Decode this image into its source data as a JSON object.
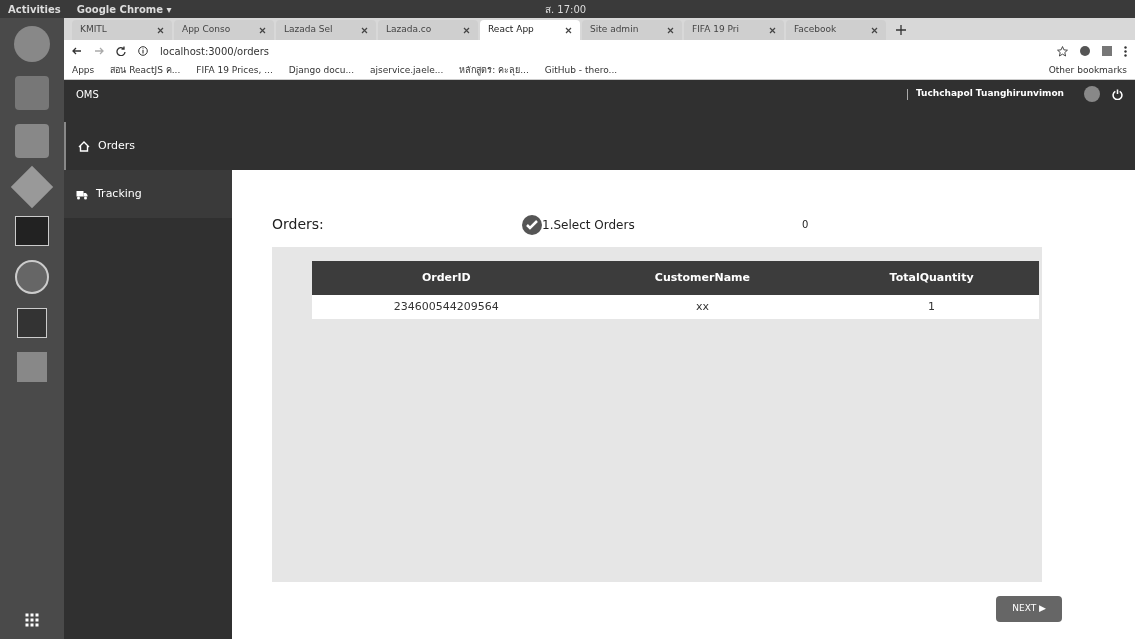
{
  "top_bar": {
    "activities": "Activities",
    "app_menu": "Google Chrome ▾",
    "clock": "ส. 17:00"
  },
  "tabs": [
    {
      "label": "KMITL",
      "selected": false
    },
    {
      "label": "App Conso",
      "selected": false
    },
    {
      "label": "Lazada Sel",
      "selected": false
    },
    {
      "label": "Lazada.co",
      "selected": false
    },
    {
      "label": "React App",
      "selected": true
    },
    {
      "label": "Site admin",
      "selected": false
    },
    {
      "label": "FIFA 19 Pri",
      "selected": false
    },
    {
      "label": "Facebook",
      "selected": false
    }
  ],
  "address": "localhost:3000/orders",
  "bookmarks": [
    "Apps",
    "สอน ReactJS ค...",
    "FIFA 19 Prices, ...",
    "Django docu...",
    "ajservice.jaele...",
    "หลักสูตร: คะลุย...",
    "GitHub - thero..."
  ],
  "other_bookmarks": "Other bookmarks",
  "app": {
    "brand": "OMS",
    "user": "Tuchchapol Tuanghirunvimon"
  },
  "sidebar": {
    "items": [
      {
        "label": "Orders",
        "kind": "home",
        "selected": true
      },
      {
        "label": "Tracking",
        "kind": "truck",
        "selected": false
      }
    ]
  },
  "content": {
    "title": "Orders:",
    "step": "1.Select Orders",
    "count": "0"
  },
  "table": {
    "columns": [
      "OrderID",
      "CustomerName",
      "TotalQuantity"
    ],
    "rows": [
      [
        "234600544209564",
        "xx",
        "1"
      ]
    ]
  },
  "next_button": "NEXT ▶"
}
